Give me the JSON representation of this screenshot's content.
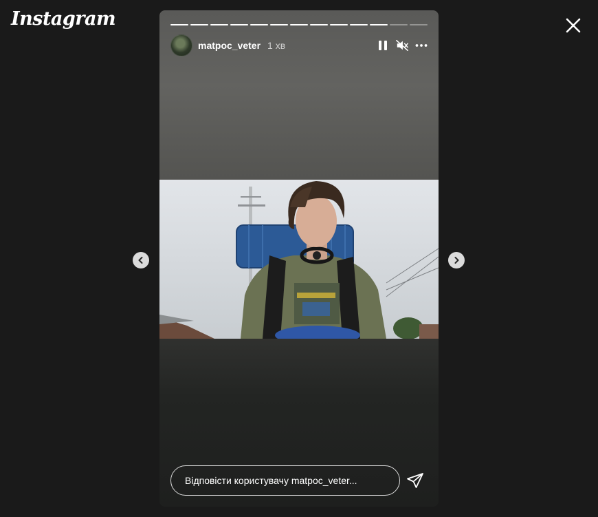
{
  "app": {
    "logo_text": "Instagram"
  },
  "story": {
    "username": "matpoc_veter",
    "time_ago": "1 хв",
    "progress_total_segments": 13,
    "progress_completed_segments": 11,
    "reply_placeholder": "Відповісти користувачу matpoc_veter..."
  },
  "icons": {
    "close": "close-icon",
    "pause": "pause-icon",
    "mute": "muted-speaker-icon",
    "more": "more-options-icon",
    "send": "send-paper-plane-icon",
    "prev": "chevron-left-icon",
    "next": "chevron-right-icon"
  },
  "colors": {
    "background": "#1a1a1a",
    "nav_button": "#dbdbdb",
    "text": "#ffffff"
  }
}
